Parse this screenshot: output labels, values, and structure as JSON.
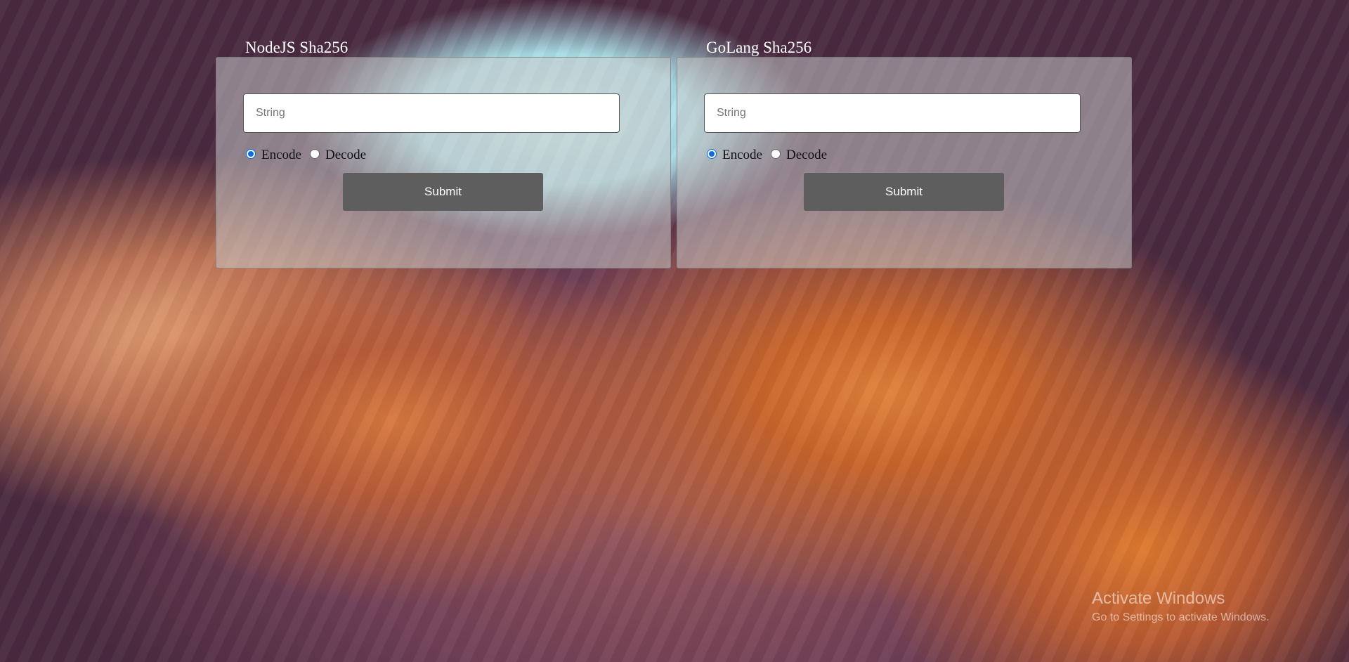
{
  "nodejs": {
    "title": "NodeJS Sha256",
    "input_placeholder": "String",
    "input_value": "",
    "options": [
      {
        "label": "Encode",
        "checked": true
      },
      {
        "label": "Decode",
        "checked": false
      }
    ],
    "submit_label": "Submit"
  },
  "golang": {
    "title": "GoLang Sha256",
    "input_placeholder": "String",
    "input_value": "",
    "options": [
      {
        "label": "Encode",
        "checked": true
      },
      {
        "label": "Decode",
        "checked": false
      }
    ],
    "submit_label": "Submit"
  },
  "watermark": {
    "line1": "Activate Windows",
    "line2": "Go to Settings to activate Windows."
  },
  "colors": {
    "radio_accent": "#0a6de0",
    "button": "#5e5e5e"
  }
}
